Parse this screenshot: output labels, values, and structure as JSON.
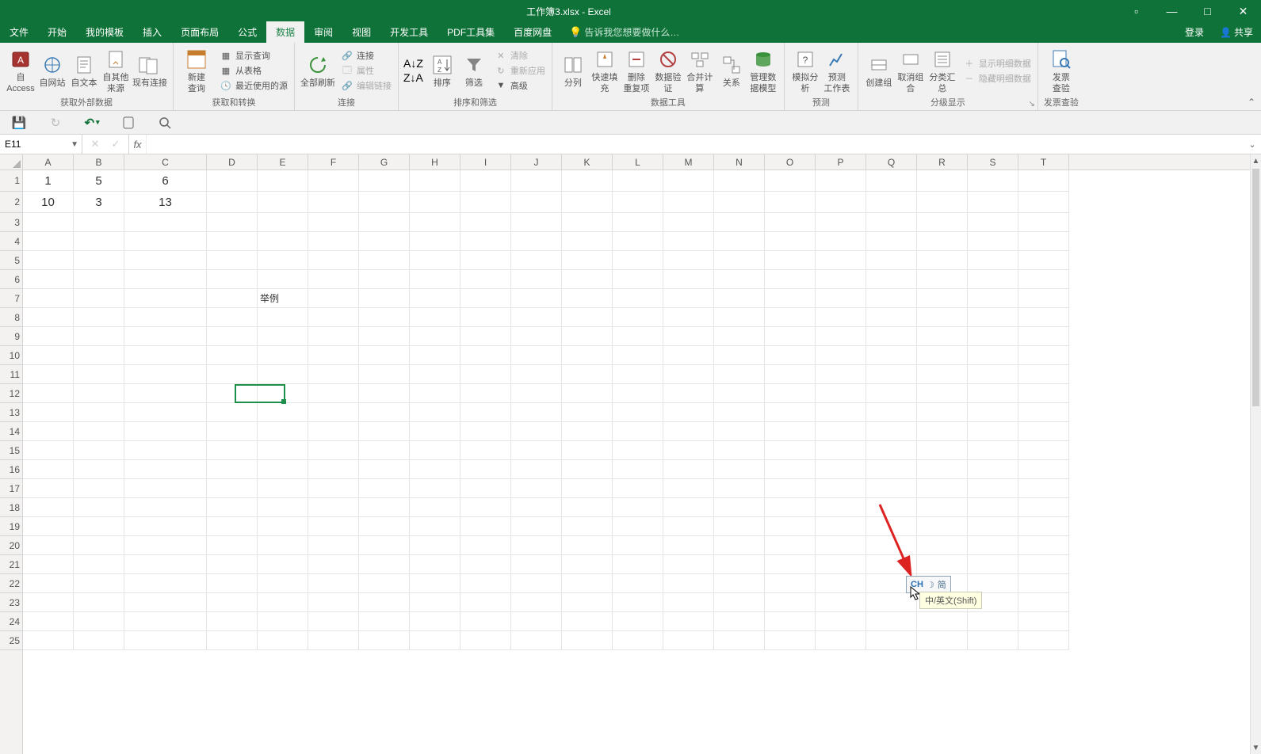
{
  "window": {
    "title": "工作簿3.xlsx - Excel"
  },
  "titlebar_controls": {
    "ribbon_opts": "▫",
    "min": "—",
    "max": "□",
    "close": "✕"
  },
  "tabs": {
    "items": [
      "文件",
      "开始",
      "我的模板",
      "插入",
      "页面布局",
      "公式",
      "数据",
      "审阅",
      "视图",
      "开发工具",
      "PDF工具集",
      "百度网盘"
    ],
    "active_index": 6,
    "tell_me_placeholder": "告诉我您想要做什么…",
    "login": "登录",
    "share": "共享"
  },
  "ribbon": {
    "groups": {
      "ext_data": {
        "label": "获取外部数据",
        "btns": {
          "access": "自 Access",
          "web": "自网站",
          "text": "自文本",
          "other": "自其他来源",
          "existing": "现有连接"
        }
      },
      "get_transform": {
        "label": "获取和转换",
        "new_query": "新建\n查询",
        "show_query": "显示查询",
        "from_table": "从表格",
        "recent": "最近使用的源"
      },
      "connections": {
        "label": "连接",
        "refresh": "全部刷新",
        "conns": "连接",
        "props": "属性",
        "edit_links": "编辑链接"
      },
      "sort_filter": {
        "label": "排序和筛选",
        "sort": "排序",
        "filter": "筛选",
        "clear": "清除",
        "reapply": "重新应用",
        "advanced": "高级"
      },
      "data_tools": {
        "label": "数据工具",
        "text_cols": "分列",
        "flash": "快速填充",
        "dedup": "删除\n重复项",
        "validate": "数据验\n证",
        "consolidate": "合并计算",
        "relations": "关系",
        "model": "管理数\n据模型"
      },
      "forecast": {
        "label": "预测",
        "whatif": "模拟分析",
        "sheet": "预测\n工作表"
      },
      "outline": {
        "label": "分级显示",
        "group": "创建组",
        "ungroup": "取消组合",
        "subtotal": "分类汇总",
        "show_detail": "显示明细数据",
        "hide_detail": "隐藏明细数据"
      },
      "invoice": {
        "label": "发票查验",
        "btn": "发票\n查验"
      }
    }
  },
  "qat": {
    "save": "💾",
    "redo": "↻",
    "undo": "↶",
    "touch_mode": "✋",
    "print_preview": "🔍"
  },
  "namebox": {
    "value": "E11"
  },
  "formula_bar": {
    "cancel": "✕",
    "enter": "✓",
    "fx": "fx",
    "value": ""
  },
  "columns": [
    "A",
    "B",
    "C",
    "D",
    "E",
    "F",
    "G",
    "H",
    "I",
    "J",
    "K",
    "L",
    "M",
    "N",
    "O",
    "P",
    "Q",
    "R",
    "S",
    "T"
  ],
  "rows_visible": 25,
  "chart_data": {
    "type": "table",
    "note": "spreadsheet cell contents visible in grid",
    "cells": {
      "A1": "1",
      "B1": "5",
      "C1": "6",
      "A2": "10",
      "B2": "3",
      "C2": "13",
      "E7": "举例"
    }
  },
  "selection": {
    "cell": "E11",
    "row": 11,
    "col": "E"
  },
  "ime": {
    "badge": "CH",
    "mode": "简",
    "tooltip": "中/英文(Shift)"
  }
}
